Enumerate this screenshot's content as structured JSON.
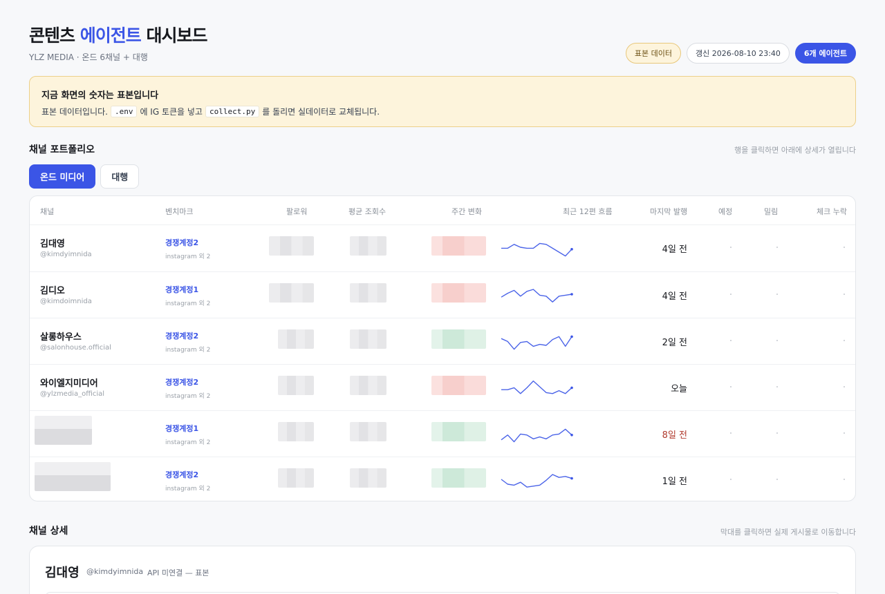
{
  "header": {
    "title_prefix": "콘텐츠 ",
    "title_accent": "에이전트",
    "title_suffix": " 대시보드",
    "subtitle": "YLZ MEDIA · 온드 6채널 + 대행",
    "badge_sample": "표본 데이터",
    "badge_updated": "갱신 2026-08-10 23:40",
    "badge_agents": "6개 에이전트"
  },
  "notice": {
    "title": "지금 화면의 숫자는 표본입니다",
    "text_1": "표본 데이터입니다.",
    "code_1": ".env",
    "text_2": "에 IG 토큰을 넣고",
    "code_2": "collect.py",
    "text_3": "를 돌리면 실데이터로 교체됩니다."
  },
  "portfolio": {
    "title": "채널 포트폴리오",
    "hint": "행을 클릭하면 아래에 상세가 열립니다",
    "tabs": [
      "온드 미디어",
      "대행"
    ],
    "active_tab": 0,
    "columns": [
      "채널",
      "벤치마크",
      "팔로워",
      "평균 조회수",
      "주간 변화",
      "최근 12편 흐름",
      "마지막 발행",
      "예정",
      "밀림",
      "체크 누락"
    ],
    "rows": [
      {
        "name": "김대영",
        "handle": "@kimdyimnida",
        "benchmark": "경쟁계정2",
        "bench_sub": "instagram 외 2",
        "trend": "down",
        "last": "4일 전",
        "late": false,
        "spark": [
          0.55,
          0.55,
          0.35,
          0.5,
          0.55,
          0.55,
          0.3,
          0.35,
          0.55,
          0.75,
          0.95,
          0.6
        ],
        "scheduled": "·",
        "delayed": "·",
        "missing": "·"
      },
      {
        "name": "김디오",
        "handle": "@kimdoimnida",
        "benchmark": "경쟁계정1",
        "bench_sub": "instagram 외 2",
        "trend": "down",
        "last": "4일 전",
        "late": false,
        "spark": [
          0.65,
          0.45,
          0.3,
          0.6,
          0.35,
          0.25,
          0.55,
          0.6,
          0.9,
          0.6,
          0.55,
          0.5
        ],
        "scheduled": "·",
        "delayed": "·",
        "missing": "·"
      },
      {
        "name": "살롱하우스",
        "handle": "@salonhouse.official",
        "benchmark": "경쟁계정2",
        "bench_sub": "instagram 외 2",
        "trend": "up",
        "last": "2일 전",
        "late": false,
        "spark": [
          0.4,
          0.55,
          0.95,
          0.6,
          0.55,
          0.8,
          0.7,
          0.75,
          0.45,
          0.3,
          0.8,
          0.3
        ],
        "scheduled": "·",
        "delayed": "·",
        "missing": "·"
      },
      {
        "name": "와이엘지미디어",
        "handle": "@ylzmedia_official",
        "benchmark": "경쟁계정2",
        "bench_sub": "instagram 외 2",
        "trend": "down",
        "last": "오늘",
        "late": false,
        "spark": [
          0.65,
          0.65,
          0.55,
          0.85,
          0.55,
          0.2,
          0.5,
          0.8,
          0.85,
          0.7,
          0.85,
          0.55
        ],
        "scheduled": "·",
        "delayed": "·",
        "missing": "·"
      },
      {
        "name": "",
        "handle": "",
        "benchmark": "경쟁계정1",
        "bench_sub": "instagram 외 2",
        "trend": "up",
        "last": "8일 전",
        "late": true,
        "spark": [
          0.85,
          0.6,
          0.95,
          0.55,
          0.6,
          0.8,
          0.7,
          0.8,
          0.6,
          0.55,
          0.3,
          0.6
        ],
        "scheduled": "·",
        "delayed": "·",
        "missing": "·"
      },
      {
        "name": "",
        "handle": "",
        "benchmark": "경쟁계정2",
        "bench_sub": "instagram 외 2",
        "trend": "up",
        "last": "1일 전",
        "late": false,
        "spark": [
          0.5,
          0.75,
          0.8,
          0.65,
          0.9,
          0.85,
          0.8,
          0.55,
          0.25,
          0.4,
          0.35,
          0.45
        ],
        "scheduled": "·",
        "delayed": "·",
        "missing": "·"
      }
    ]
  },
  "detail": {
    "title": "채널 상세",
    "hint": "막대를 클릭하면 실제 게시물로 이동합니다",
    "name": "김대영",
    "handle": "@kimdyimnida",
    "status": "API 미연결 — 표본"
  },
  "colors": {
    "accent": "#3b55e6",
    "late": "#b03a2e",
    "notice_bg": "#fdf4dc"
  }
}
